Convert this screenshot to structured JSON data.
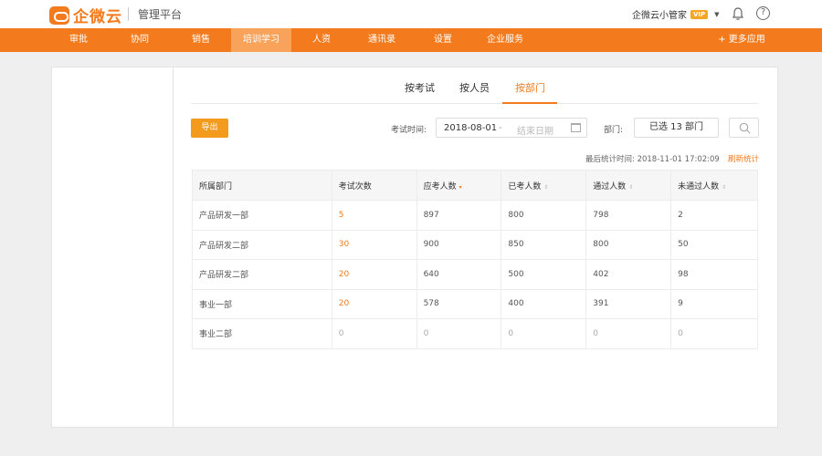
{
  "header": {
    "brand": "企微云",
    "platform": "管理平台",
    "user_name": "企微云小管家",
    "vip_badge": "VIP",
    "help_glyph": "?"
  },
  "nav": {
    "items": [
      "审批",
      "协同",
      "销售",
      "培训学习",
      "人资",
      "通讯录",
      "设置",
      "企业服务"
    ],
    "active_index": 3,
    "more": "+ 更多应用"
  },
  "tabs": [
    "按考试",
    "按人员",
    "按部门"
  ],
  "active_tab": 2,
  "toolbar": {
    "export_label": "导出",
    "exam_time_label": "考试时间:",
    "date_start": "2018-08-01",
    "date_dash": "-",
    "date_end_placeholder": "结束日期",
    "dept_label": "部门:",
    "dept_value": "已选 13 部门"
  },
  "stats": {
    "last_stat_label": "最后统计时间: 2018-11-01 17:02:09",
    "refresh_label": "刷新统计"
  },
  "table": {
    "headers": [
      "所属部门",
      "考试次数",
      "应考人数",
      "已考人数",
      "通过人数",
      "未通过人数"
    ],
    "sort_symbol": "⇕",
    "sort_active_symbol": "▾",
    "rows": [
      [
        "产品研发一部",
        "5",
        "897",
        "800",
        "798",
        "2"
      ],
      [
        "产品研发二部",
        "30",
        "900",
        "850",
        "800",
        "50"
      ],
      [
        "产品研发二部",
        "20",
        "640",
        "500",
        "402",
        "98"
      ],
      [
        "事业一部",
        "20",
        "578",
        "400",
        "391",
        "9"
      ],
      [
        "事业二部",
        "0",
        "0",
        "0",
        "0",
        "0"
      ]
    ]
  },
  "colors": {
    "brand_orange": "#f37b1d",
    "nav_active": "#f8a25a",
    "export_button": "#f39b1d"
  }
}
